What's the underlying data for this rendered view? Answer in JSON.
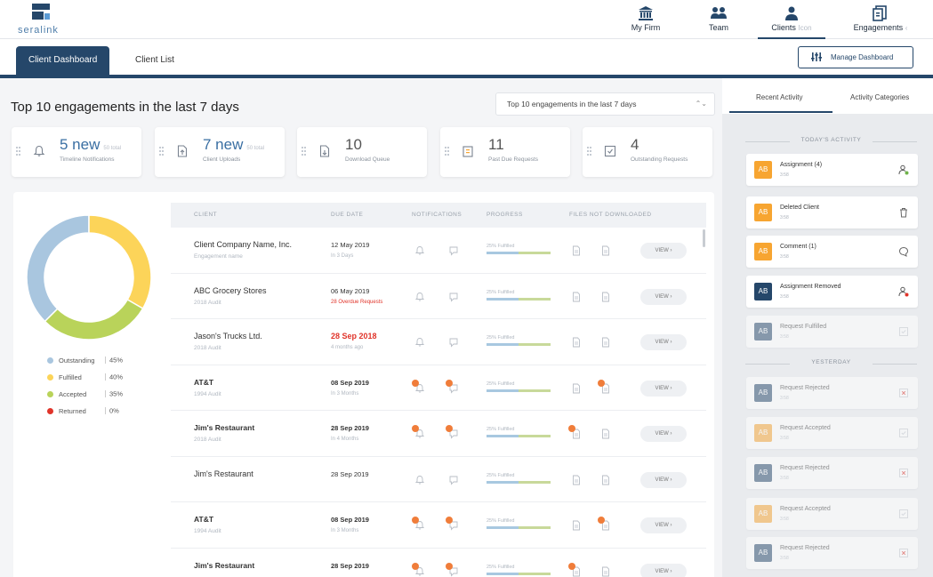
{
  "brand": {
    "logo_text": "seralink"
  },
  "nav": {
    "my_firm": "My Firm",
    "team": "Team",
    "clients": "Clients",
    "clients_sub": "Icon",
    "engagements": "Engagements"
  },
  "tabs": {
    "client_dashboard": "Client Dashboard",
    "client_list": "Client List"
  },
  "manage_dashboard": "Manage Dashboard",
  "page_title": "Top 10 engagements in the last 7 days",
  "select_value": "Top 10 engagements in the last 7 days",
  "stats": [
    {
      "value": "5 new",
      "sub": "50 total",
      "label": "Timeline Notifications",
      "icon": "bell-icon"
    },
    {
      "value": "7 new",
      "sub": "50 total",
      "label": "Client Uploads",
      "icon": "upload-doc-icon"
    },
    {
      "value": "10",
      "sub": "",
      "label": "Download Queue",
      "icon": "download-doc-icon"
    },
    {
      "value": "11",
      "sub": "",
      "label": "Past Due Requests",
      "icon": "calendar-icon"
    },
    {
      "value": "4",
      "sub": "",
      "label": "Outstanding Requests",
      "icon": "checkbox-icon"
    }
  ],
  "colors": {
    "outstanding": "#a9c6df",
    "fulfilled": "#fcd459",
    "accepted": "#b9d35a",
    "returned": "#e0342a",
    "primary": "#25476a",
    "orange": "#f7a531"
  },
  "chart_data": {
    "type": "pie",
    "categories": [
      "Outstanding",
      "Fulfilled",
      "Accepted",
      "Returned"
    ],
    "values": [
      45,
      40,
      35,
      0
    ],
    "labels": [
      "45%",
      "40%",
      "35%",
      "0%"
    ]
  },
  "table": {
    "headers": [
      "CLIENT",
      "DUE DATE",
      "NOTIFICATIONS",
      "PROGRESS",
      "FILES NOT DOWNLOADED"
    ],
    "progress_label": "25% Fulfilled",
    "view_label": "VIEW",
    "rows": [
      {
        "client": "Client Company Name, Inc.",
        "sub": "Engagement name",
        "date": "12 May 2019",
        "date_sub": "In 3 Days",
        "style": "normal",
        "date_style": "normal",
        "notif": [
          false,
          false
        ],
        "files": [
          false,
          false
        ]
      },
      {
        "client": "ABC Grocery Stores",
        "sub": "2018 Audit",
        "date": "06 May 2019",
        "date_sub": "28 Overdue Requests",
        "style": "normal",
        "date_style": "sub-red",
        "notif": [
          false,
          false
        ],
        "files": [
          false,
          false
        ]
      },
      {
        "client": "Jason's Trucks Ltd.",
        "sub": "2018 Audit",
        "date": "28 Sep 2018",
        "date_sub": "4 months ago",
        "style": "normal",
        "date_style": "red",
        "notif": [
          false,
          false
        ],
        "files": [
          false,
          false
        ]
      },
      {
        "client": "AT&T",
        "sub": "1994 Audit",
        "date": "08 Sep 2019",
        "date_sub": "In 3 Months",
        "style": "bold",
        "date_style": "bold",
        "notif": [
          true,
          true
        ],
        "files": [
          false,
          true
        ]
      },
      {
        "client": "Jim's Restaurant",
        "sub": "2018 Audit",
        "date": "28 Sep 2019",
        "date_sub": "In 4 Months",
        "style": "bold",
        "date_style": "bold",
        "notif": [
          true,
          true
        ],
        "files": [
          true,
          false
        ]
      },
      {
        "client": "Jim's Restaurant",
        "sub": "",
        "date": "28 Sep 2019",
        "date_sub": "",
        "style": "normal",
        "date_style": "normal",
        "notif": [
          false,
          false
        ],
        "files": [
          false,
          false
        ]
      },
      {
        "client": "AT&T",
        "sub": "1994 Audit",
        "date": "08 Sep 2019",
        "date_sub": "In 3 Months",
        "style": "bold",
        "date_style": "bold",
        "notif": [
          true,
          true
        ],
        "files": [
          false,
          true
        ]
      },
      {
        "client": "Jim's Restaurant",
        "sub": "",
        "date": "28 Sep 2019",
        "date_sub": "",
        "style": "bold",
        "date_style": "bold",
        "notif": [
          true,
          true
        ],
        "files": [
          true,
          false
        ]
      }
    ]
  },
  "sidebar": {
    "tab_recent": "Recent Activity",
    "tab_categories": "Activity Categories",
    "today": "TODAY'S ACTIVITY",
    "yesterday": "YESTERDAY",
    "activities": [
      {
        "initials": "AB",
        "title": "Assignment (4)",
        "time": "3:58",
        "color": "orange",
        "icon": "assign-user-icon",
        "faded": false
      },
      {
        "initials": "AB",
        "title": "Deleted Client",
        "time": "3:58",
        "color": "orange",
        "icon": "trash-icon",
        "faded": false
      },
      {
        "initials": "AB",
        "title": "Comment (1)",
        "time": "3:58",
        "color": "orange",
        "icon": "comment-icon",
        "faded": false
      },
      {
        "initials": "AB",
        "title": "Assignment Removed",
        "time": "3:58",
        "color": "primary",
        "icon": "remove-user-icon",
        "faded": false
      },
      {
        "initials": "AB",
        "title": "Request Fulfilled",
        "time": "3:58",
        "color": "primary",
        "icon": "check-square-icon",
        "faded": true
      }
    ],
    "yesterday_activities": [
      {
        "initials": "AB",
        "title": "Request Rejected",
        "time": "3:58",
        "color": "primary",
        "icon": "x-square-icon"
      },
      {
        "initials": "AB",
        "title": "Request Accepted",
        "time": "3:58",
        "color": "orange",
        "icon": "check-square-icon"
      },
      {
        "initials": "AB",
        "title": "Request Rejected",
        "time": "3:58",
        "color": "primary",
        "icon": "x-square-icon"
      },
      {
        "initials": "AB",
        "title": "Request Accepted",
        "time": "3:58",
        "color": "orange",
        "icon": "check-square-icon"
      },
      {
        "initials": "AB",
        "title": "Request Rejected",
        "time": "3:58",
        "color": "primary",
        "icon": "x-square-icon"
      }
    ]
  }
}
